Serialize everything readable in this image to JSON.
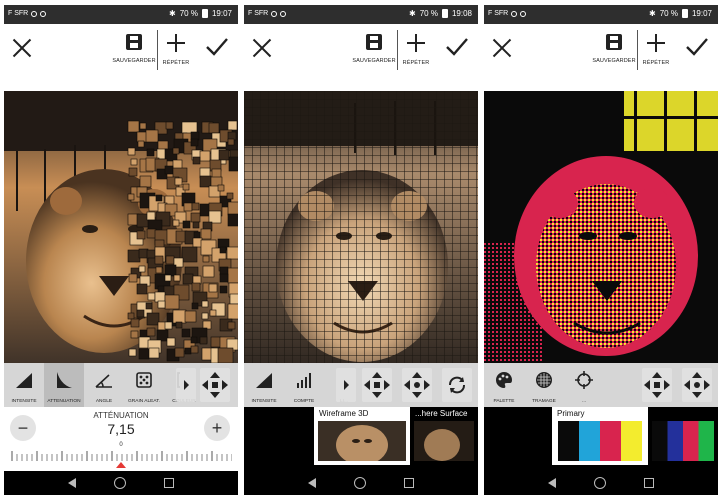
{
  "status_bar": {
    "carrier": "F SFR",
    "battery_label": "70 %",
    "times": [
      "19:07",
      "19:08",
      "19:07"
    ]
  },
  "toolbar": {
    "save_label": "SAUVEGARDER",
    "repeat_label": "RÉPÉTER"
  },
  "screen1": {
    "tools": [
      "INTENSITÉ",
      "ATTÉNUATION",
      "ANGLE",
      "GRAIN ALÉAT.",
      "COULEUR"
    ],
    "selected_tool": "ATTÉNUATION",
    "parameter": {
      "label": "ATTÉNUATION",
      "value": "7,15",
      "ruler_zero": "0",
      "minus": "−",
      "plus": "+"
    }
  },
  "screen2": {
    "tools": [
      "INTENSITÉ",
      "COMPTE",
      "LI..."
    ],
    "presets": [
      {
        "title": "Wireframe 3D",
        "selected": true
      },
      {
        "title": "...here Surface",
        "selected": false
      }
    ]
  },
  "screen3": {
    "tools": [
      "PALETTE",
      "TRAMAGE",
      "..."
    ],
    "presets": [
      {
        "title": "Primary",
        "selected": true,
        "swatches": [
          "#0a0a0a",
          "#21a4d9",
          "#d8244e",
          "#f3ec2e"
        ]
      },
      {
        "title": "",
        "selected": false,
        "swatches": [
          "#0a0a0a",
          "#23309b",
          "#d8244e",
          "#1fb54a"
        ]
      }
    ]
  },
  "colors": {
    "status_bg": "#2e2e2e",
    "toolstrip_bg": "#d6d6d6",
    "selected_tool_bg": "#bcbcbc",
    "accent_marker": "#e53935"
  }
}
